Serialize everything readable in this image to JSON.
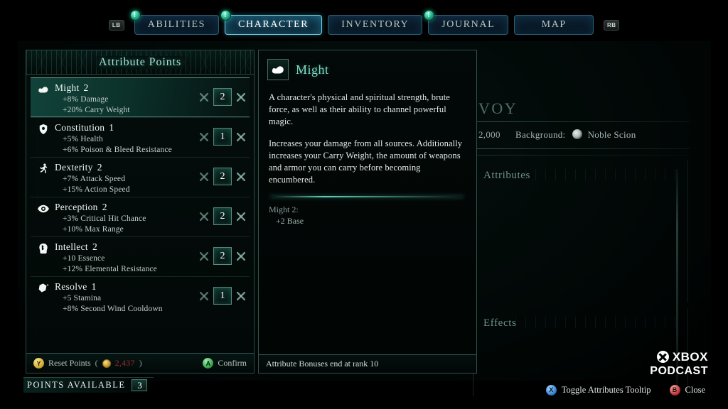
{
  "tabs": {
    "left_bumper": "LB",
    "right_bumper": "RB",
    "items": [
      {
        "label": "ABILITIES",
        "active": false,
        "badge": "!"
      },
      {
        "label": "CHARACTER",
        "active": true,
        "badge": "!"
      },
      {
        "label": "INVENTORY",
        "active": false,
        "badge": ""
      },
      {
        "label": "JOURNAL",
        "active": false,
        "badge": "!"
      },
      {
        "label": "MAP",
        "active": false,
        "badge": ""
      }
    ]
  },
  "attribute_panel": {
    "title": "Attribute Points",
    "rows": [
      {
        "name": "Might",
        "level": "2",
        "value": "2",
        "selected": true,
        "icon": "bicep-icon",
        "bonuses": [
          "+8% Damage",
          "+20% Carry Weight"
        ]
      },
      {
        "name": "Constitution",
        "level": "1",
        "value": "1",
        "selected": false,
        "icon": "shield-heart-icon",
        "bonuses": [
          "+5% Health",
          "+6% Poison & Bleed Resistance"
        ]
      },
      {
        "name": "Dexterity",
        "level": "2",
        "value": "2",
        "selected": false,
        "icon": "runner-icon",
        "bonuses": [
          "+7% Attack Speed",
          "+15% Action Speed"
        ]
      },
      {
        "name": "Perception",
        "level": "2",
        "value": "2",
        "selected": false,
        "icon": "eye-icon",
        "bonuses": [
          "+3% Critical Hit Chance",
          "+10% Max Range"
        ]
      },
      {
        "name": "Intellect",
        "level": "2",
        "value": "2",
        "selected": false,
        "icon": "brain-head-icon",
        "bonuses": [
          "+10 Essence",
          "+12% Elemental Resistance"
        ]
      },
      {
        "name": "Resolve",
        "level": "1",
        "value": "1",
        "selected": false,
        "icon": "gem-icon",
        "bonuses": [
          "+5 Stamina",
          "+8% Second Wind Cooldown"
        ]
      }
    ],
    "footer": {
      "reset_button": "Y",
      "reset_label": "Reset Points",
      "reset_cost": "2,437",
      "paren_open": "(",
      "paren_close": ")",
      "confirm_button": "A",
      "confirm_label": "Confirm"
    }
  },
  "tooltip": {
    "title": "Might",
    "icon": "bicep-icon",
    "paragraphs": [
      "A character's physical and spiritual strength, brute force, as well as their ability to channel powerful magic.",
      "Increases your damage from all sources. Additionally increases your Carry Weight, the amount of weapons and armor you can carry before becoming encumbered."
    ],
    "rank_header": "Might 2:",
    "rank_detail": "+2 Base",
    "footer_note": "Attribute Bonuses end at rank 10"
  },
  "background_sheet": {
    "character_title": "VOY",
    "gold": "2,000",
    "background_label": "Background:",
    "background_value": "Noble Scion",
    "attributes_header": "Attributes",
    "effects_header": "Effects"
  },
  "bottom_bar": {
    "points_available_label": "POINTS AVAILABLE",
    "points_available_value": "3",
    "hints": [
      {
        "button": "X",
        "label": "Toggle Attributes Tooltip",
        "color": "#2a76c9"
      },
      {
        "button": "B",
        "label": "Close",
        "color": "#b32a2a"
      }
    ]
  },
  "watermark": {
    "line1": "XBOX",
    "line2": "PODCAST"
  },
  "theme": {
    "accent_teal": "#7fd9c4",
    "panel_border": "#6eafa0",
    "tab_active_border": "#6fd3e8",
    "cost_red": "#9a2b2b",
    "gold": "#c79b2e"
  }
}
